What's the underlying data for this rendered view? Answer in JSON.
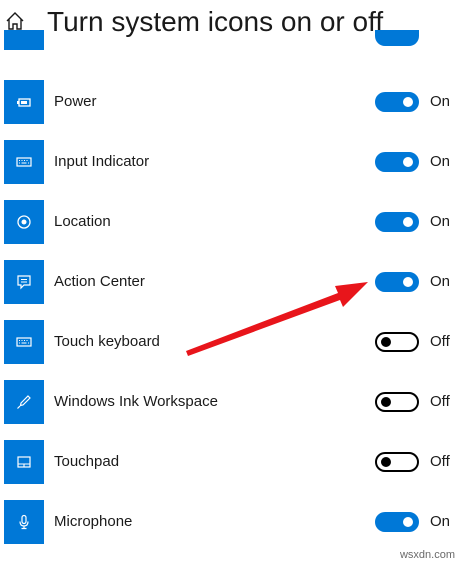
{
  "header": {
    "title": "Turn system icons on or off"
  },
  "settings": [
    {
      "label": "Power",
      "icon": "battery-icon",
      "state": "On"
    },
    {
      "label": "Input Indicator",
      "icon": "keyboard-icon",
      "state": "On"
    },
    {
      "label": "Location",
      "icon": "location-icon",
      "state": "On"
    },
    {
      "label": "Action Center",
      "icon": "action-center-icon",
      "state": "On"
    },
    {
      "label": "Touch keyboard",
      "icon": "keyboard-icon",
      "state": "Off"
    },
    {
      "label": "Windows Ink Workspace",
      "icon": "pen-icon",
      "state": "Off"
    },
    {
      "label": "Touchpad",
      "icon": "touchpad-icon",
      "state": "Off"
    },
    {
      "label": "Microphone",
      "icon": "microphone-icon",
      "state": "On"
    }
  ],
  "watermark": "wsxdn.com",
  "colors": {
    "accent": "#0078d7",
    "annotation_arrow": "#e8151b"
  }
}
